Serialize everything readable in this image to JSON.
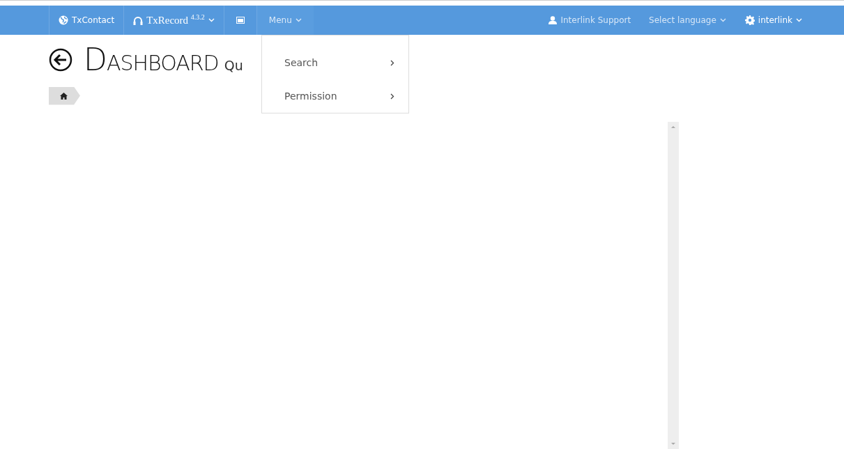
{
  "navbar": {
    "left": [
      {
        "kind": "brand",
        "label": "TxContact"
      },
      {
        "kind": "product",
        "label": "TxRecord",
        "version": "4.3.2",
        "dropdown": true
      },
      {
        "kind": "icon"
      },
      {
        "kind": "menu",
        "label": "Menu",
        "dropdown": true,
        "expanded": true
      }
    ],
    "right": [
      {
        "kind": "user",
        "label": "Interlink Support",
        "dropdown": false
      },
      {
        "kind": "language",
        "label": "Select language",
        "dropdown": true
      },
      {
        "kind": "account",
        "label": "interlink",
        "dropdown": true
      }
    ]
  },
  "menu_dropdown": [
    {
      "label": "Search",
      "submenu": true
    },
    {
      "label": "Permission",
      "submenu": true
    }
  ],
  "page": {
    "title": "DASHBOARD",
    "subtitle": "Qu"
  }
}
